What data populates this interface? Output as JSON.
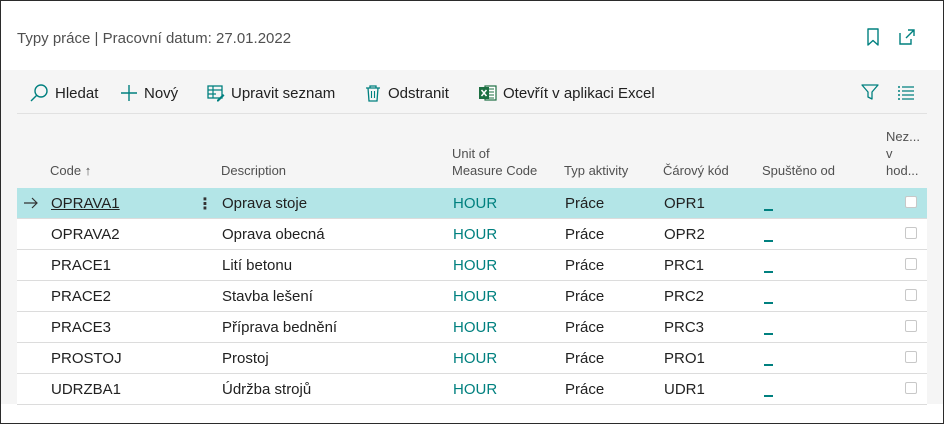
{
  "header": {
    "title": "Typy práce | Pracovní datum: 27.01.2022"
  },
  "toolbar": {
    "search_label": "Hledat",
    "new_label": "Nový",
    "edit_list_label": "Upravit seznam",
    "delete_label": "Odstranit",
    "excel_label": "Otevřít v aplikaci Excel"
  },
  "columns": {
    "code": "Code",
    "code_sort": "↑",
    "description": "Description",
    "uom_line1": "Unit of",
    "uom_line2": "Measure Code",
    "activity": "Typ aktivity",
    "barcode": "Čárový kód",
    "started": "Spuštěno od",
    "nez_line1": "Nez...",
    "nez_line2": "v",
    "nez_line3": "hod..."
  },
  "rows": [
    {
      "code": "OPRAVA1",
      "description": "Oprava stoje",
      "uom": "HOUR",
      "activity": "Práce",
      "barcode": "OPR1",
      "selected": true
    },
    {
      "code": "OPRAVA2",
      "description": "Oprava obecná",
      "uom": "HOUR",
      "activity": "Práce",
      "barcode": "OPR2"
    },
    {
      "code": "PRACE1",
      "description": "Lití betonu",
      "uom": "HOUR",
      "activity": "Práce",
      "barcode": "PRC1"
    },
    {
      "code": "PRACE2",
      "description": "Stavba lešení",
      "uom": "HOUR",
      "activity": "Práce",
      "barcode": "PRC2"
    },
    {
      "code": "PRACE3",
      "description": "Příprava bednění",
      "uom": "HOUR",
      "activity": "Práce",
      "barcode": "PRC3"
    },
    {
      "code": "PROSTOJ",
      "description": "Prostoj",
      "uom": "HOUR",
      "activity": "Práce",
      "barcode": "PRO1"
    },
    {
      "code": "UDRZBA1",
      "description": "Údržba strojů",
      "uom": "HOUR",
      "activity": "Práce",
      "barcode": "UDR1"
    }
  ],
  "colors": {
    "accent": "#00807f",
    "selected_row": "#b3e5e7",
    "excel_green": "#1d6f42"
  }
}
